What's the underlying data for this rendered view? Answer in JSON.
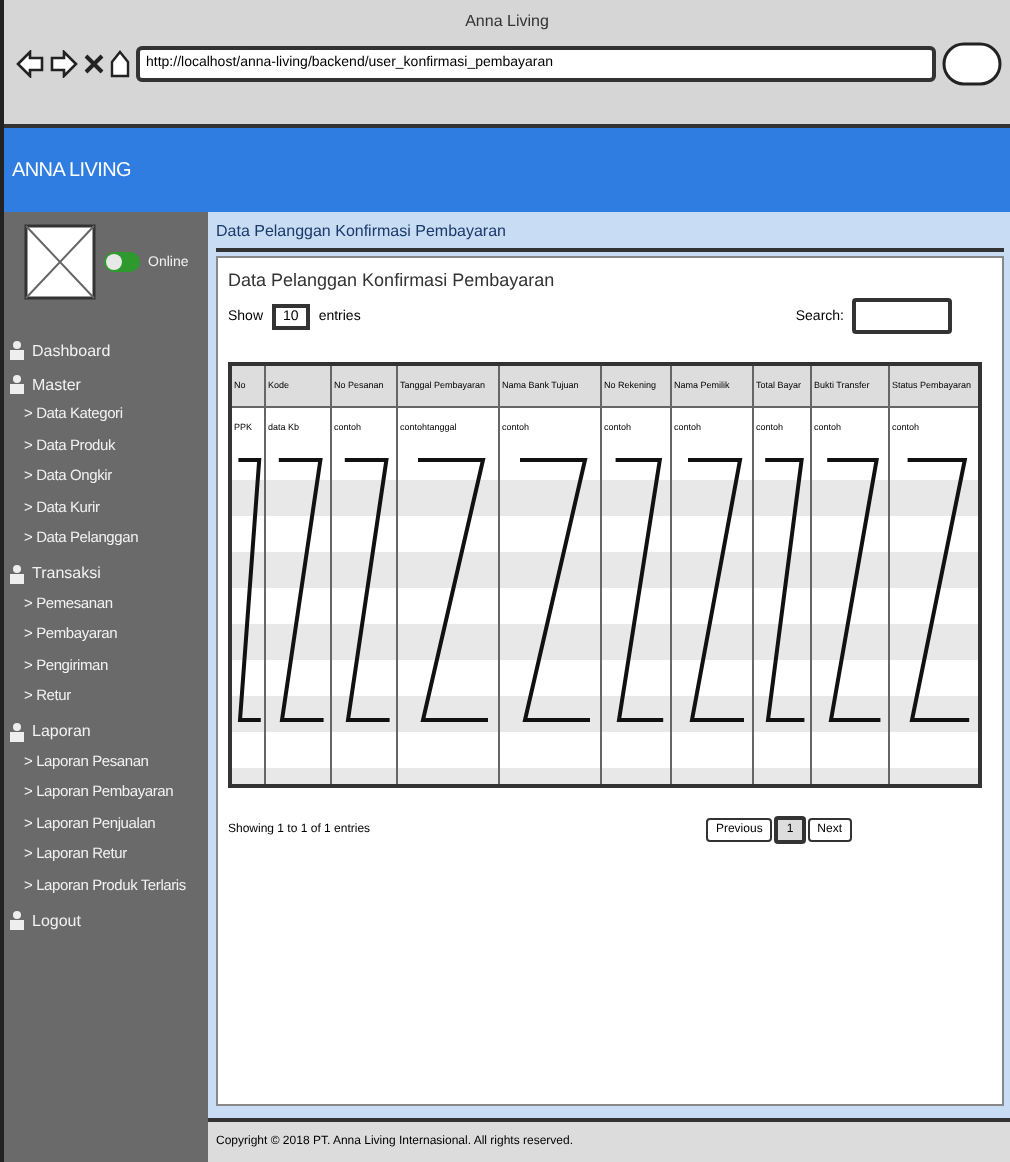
{
  "browser": {
    "title": "Anna Living",
    "url": "http://localhost/anna-living/backend/user_konfirmasi_pembayaran"
  },
  "brand": "ANNA LIVING",
  "sidebar": {
    "status": {
      "label": "Online",
      "on": true
    },
    "items": [
      {
        "label": "Dashboard"
      },
      {
        "label": "Master",
        "children": [
          {
            "label": "> Data Kategori"
          },
          {
            "label": "> Data Produk"
          },
          {
            "label": "> Data Ongkir"
          },
          {
            "label": "> Data Kurir"
          },
          {
            "label": "> Data Pelanggan"
          }
        ]
      },
      {
        "label": "Transaksi",
        "children": [
          {
            "label": "> Pemesanan"
          },
          {
            "label": "> Pembayaran"
          },
          {
            "label": "> Pengiriman"
          },
          {
            "label": "> Retur"
          }
        ]
      },
      {
        "label": "Laporan",
        "children": [
          {
            "label": "> Laporan Pesanan"
          },
          {
            "label": "> Laporan Pembayaran"
          },
          {
            "label": "> Laporan Penjualan"
          },
          {
            "label": "> Laporan Retur"
          },
          {
            "label": "> Laporan Produk Terlaris"
          }
        ]
      },
      {
        "label": "Logout"
      }
    ]
  },
  "breadcrumb": "Data Pelanggan Konfirmasi Pembayaran",
  "panel": {
    "heading": "Data Pelanggan Konfirmasi Pembayaran",
    "show_label": "Show",
    "show_value": "10",
    "entries_label": "entries",
    "search_label": "Search:",
    "table": {
      "columns": [
        "No",
        "Kode",
        "No Pesanan",
        "Tanggal Pembayaran",
        "Nama Bank Tujuan",
        "No Rekening",
        "Nama Pemilik",
        "Total Bayar",
        "Bukti Transfer",
        "Status Pembayaran"
      ],
      "rows": [
        [
          "PPK",
          "data Kb",
          "contoh",
          "contohtanggal",
          "contoh",
          "contoh",
          "contoh",
          "contoh",
          "contoh",
          "contoh"
        ]
      ]
    },
    "info": "Showing 1 to 1 of 1 entries",
    "pagination": [
      {
        "label": "Previous",
        "selected": false
      },
      {
        "label": "1",
        "selected": true
      },
      {
        "label": "Next",
        "selected": false
      }
    ]
  },
  "footer": "Copyright © 2018 PT. Anna Living Internasional. All rights reserved."
}
